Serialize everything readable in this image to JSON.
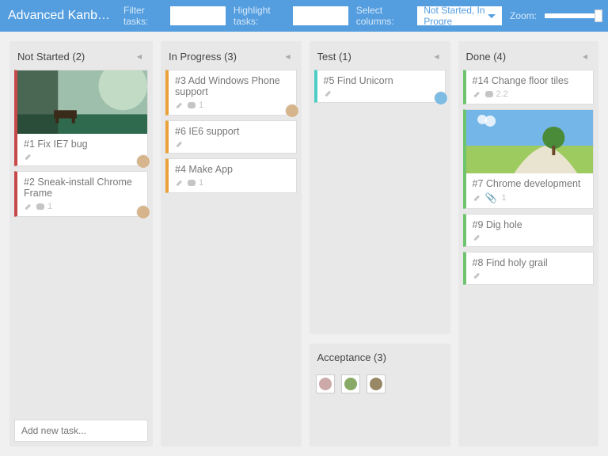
{
  "header": {
    "title": "Advanced Kanban Bo…",
    "filter_label": "Filter tasks:",
    "highlight_label": "Highlight tasks:",
    "select_label": "Select columns:",
    "select_value": "Not Started, In Progre",
    "zoom_label": "Zoom:"
  },
  "columns": {
    "not_started": {
      "label": "Not Started (2)"
    },
    "in_progress": {
      "label": "In Progress (3)"
    },
    "test": {
      "label": "Test (1)"
    },
    "acceptance": {
      "label": "Acceptance (3)"
    },
    "done": {
      "label": "Done (4)"
    }
  },
  "cards": {
    "c1": {
      "title": "#1 Fix IE7 bug"
    },
    "c2": {
      "title": "#2 Sneak-install Chrome Frame",
      "comments": "1"
    },
    "c3": {
      "title": "#3 Add Windows Phone support",
      "comments": "1"
    },
    "c6": {
      "title": "#6 IE6 support"
    },
    "c4": {
      "title": "#4 Make App",
      "comments": "1"
    },
    "c5": {
      "title": "#5 Find Unicorn"
    },
    "c14": {
      "title": "#14 Change floor tiles",
      "comments": "2.2"
    },
    "c7": {
      "title": "#7 Chrome development",
      "attach": "1"
    },
    "c9": {
      "title": "#9 Dig hole"
    },
    "c8": {
      "title": "#8 Find holy grail"
    }
  },
  "add_task_placeholder": "Add new task..."
}
